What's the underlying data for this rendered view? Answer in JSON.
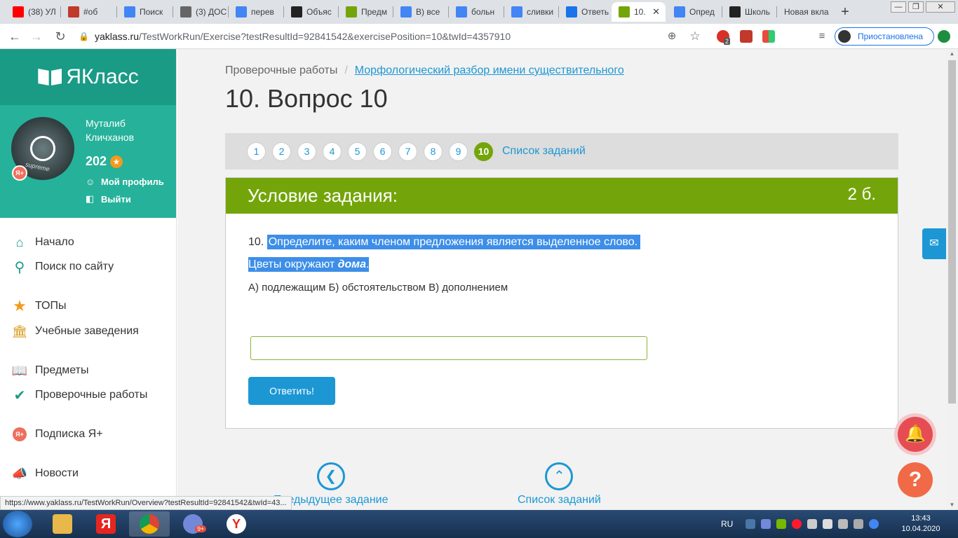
{
  "browser": {
    "tabs": [
      {
        "label": "(38) УЛ",
        "fav_color": "#ff0000",
        "fav_icon": "youtube-icon"
      },
      {
        "label": "#об",
        "fav_color": "#c0392b",
        "fav_icon": "2k-icon"
      },
      {
        "label": "Поиск",
        "fav_color": "#4285f4",
        "fav_icon": "google-icon"
      },
      {
        "label": "(3) ДОС",
        "fav_color": "#666666",
        "fav_icon": "roblox-icon"
      },
      {
        "label": "перев",
        "fav_color": "#4285f4",
        "fav_icon": "google-icon"
      },
      {
        "label": "Объяс",
        "fav_color": "#222222",
        "fav_icon": "znanija-icon"
      },
      {
        "label": "Предм",
        "fav_color": "#73a50a",
        "fav_icon": "yaklass-icon"
      },
      {
        "label": "В) все",
        "fav_color": "#4285f4",
        "fav_icon": "google-icon"
      },
      {
        "label": "больн",
        "fav_color": "#4285f4",
        "fav_icon": "google-icon"
      },
      {
        "label": "сливки",
        "fav_color": "#4285f4",
        "fav_icon": "google-icon"
      },
      {
        "label": "Ответь",
        "fav_color": "#1a73e8",
        "fav_icon": "question-icon"
      },
      {
        "label": "10.",
        "fav_color": "#73a50a",
        "fav_icon": "yaklass-icon",
        "active": true
      },
      {
        "label": "Опред",
        "fav_color": "#4285f4",
        "fav_icon": "google-icon"
      },
      {
        "label": "Школь",
        "fav_color": "#222222",
        "fav_icon": "znanija-icon"
      },
      {
        "label": "Новая вкла",
        "fav_color": "",
        "fav_icon": ""
      }
    ],
    "url_host": "yaklass.ru",
    "url_path": "/TestWorkRun/Exercise?testResultId=92841542&exercisePosition=10&twId=4357910",
    "profile_label": "Приостановлена",
    "ext_badge": "2",
    "status_url": "https://www.yaklass.ru/TestWorkRun/Overview?testResultId=92841542&twId=43..."
  },
  "sidebar": {
    "logo": "ЯКласс",
    "user_name": "Муталиб Кличханов",
    "points": "202",
    "avatar_badge": "Я+",
    "avatar_caption": "supreme",
    "profile_link": "Мой профиль",
    "logout_link": "Выйти",
    "menu": [
      {
        "label": "Начало",
        "icon": "home-icon"
      },
      {
        "label": "Поиск по сайту",
        "icon": "search-icon"
      },
      {
        "label": "ТОПы",
        "icon": "star-icon"
      },
      {
        "label": "Учебные заведения",
        "icon": "school-icon"
      },
      {
        "label": "Предметы",
        "icon": "book-icon"
      },
      {
        "label": "Проверочные работы",
        "icon": "check-icon"
      },
      {
        "label": "Подписка Я+",
        "icon": "ya-plus-icon"
      },
      {
        "label": "Новости",
        "icon": "megaphone-icon"
      }
    ]
  },
  "main": {
    "breadcrumb_root": "Проверочные работы",
    "breadcrumb_sep": "/",
    "breadcrumb_link": "Морфологический разбор имени существительного",
    "title": "10. Вопрос 10",
    "question_numbers": [
      "1",
      "2",
      "3",
      "4",
      "5",
      "6",
      "7",
      "8",
      "9",
      "10"
    ],
    "current_question": "10",
    "task_list_link": "Список заданий",
    "card_header": "Условие задания:",
    "card_points": "2 б.",
    "q_prefix": "10.",
    "q_text": "Определите, каким членом предложения является выделенное слово.",
    "sentence_pre": "Цветы окружают",
    "sentence_word": "дома",
    "sentence_post": ".",
    "options": "А) подлежащим Б) обстоятельством В) дополнением",
    "answer_value": "",
    "submit_label": "Ответить!",
    "prev_label": "Предыдущее задание",
    "tasklist_label": "Список заданий"
  },
  "taskbar": {
    "lang": "RU",
    "time": "13:43",
    "date": "10.04.2020",
    "discord_badge": "9+"
  }
}
